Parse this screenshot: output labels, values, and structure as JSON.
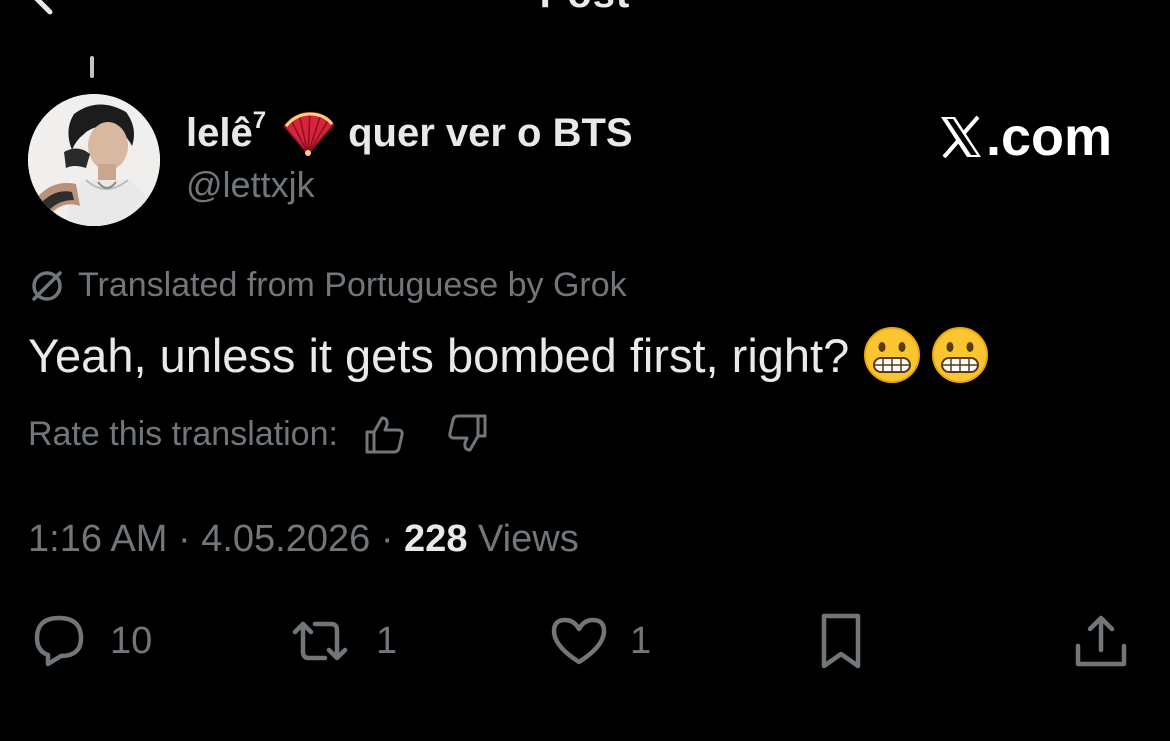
{
  "header": {
    "title": "Post"
  },
  "author": {
    "display_name": "lelê",
    "name_superscript": "7",
    "name_suffix": "quer ver o BTS",
    "handle": "@lettxjk"
  },
  "watermark": {
    "text": ".com"
  },
  "translation": {
    "notice": "Translated from Portuguese by Grok",
    "rate_label": "Rate this translation:"
  },
  "post": {
    "text": "Yeah, unless it gets bombed first, right?",
    "emoji": [
      "grimacing-face",
      "grimacing-face"
    ]
  },
  "meta": {
    "time": "1:16 AM",
    "separator": "·",
    "date": "4.05.2026",
    "views_count": "228",
    "views_label": "Views"
  },
  "actions": {
    "replies": "10",
    "reposts": "1",
    "likes": "1"
  },
  "colors": {
    "background": "#000000",
    "primary_text": "#e7e9ea",
    "secondary_text": "#71767b"
  }
}
